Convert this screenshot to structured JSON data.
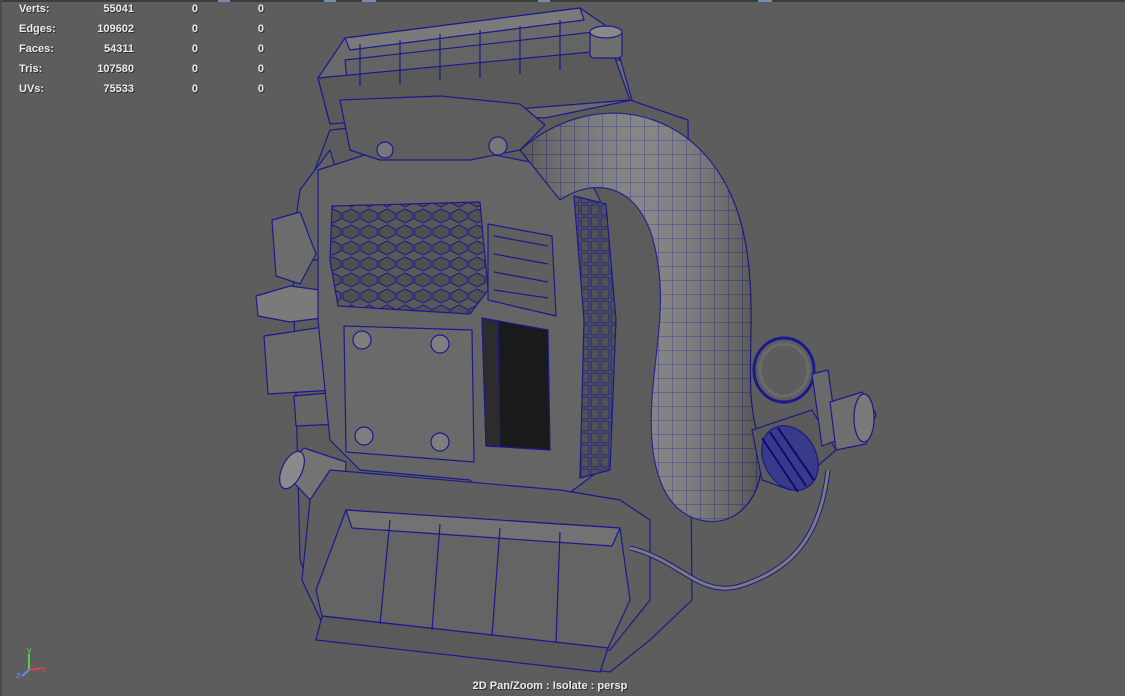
{
  "hud": {
    "rows": [
      {
        "label": "Verts:",
        "v1": "55041",
        "v2": "0",
        "v3": "0"
      },
      {
        "label": "Edges:",
        "v1": "109602",
        "v2": "0",
        "v3": "0"
      },
      {
        "label": "Faces:",
        "v1": "54311",
        "v2": "0",
        "v3": "0"
      },
      {
        "label": "Tris:",
        "v1": "107580",
        "v2": "0",
        "v3": "0"
      },
      {
        "label": "UVs:",
        "v1": "75533",
        "v2": "0",
        "v3": "0"
      }
    ]
  },
  "viewport": {
    "status_label": "2D Pan/Zoom : Isolate : persp",
    "background_color": "#5d5d5d",
    "wire_color": "#1a1a8c",
    "mesh_color": "#6a6a6a"
  },
  "gizmo": {
    "y_label": "y",
    "z_label": "z",
    "x_label": "x",
    "y_color": "#4fd04f",
    "x_color": "#e04040",
    "z_color": "#5a8cff"
  }
}
